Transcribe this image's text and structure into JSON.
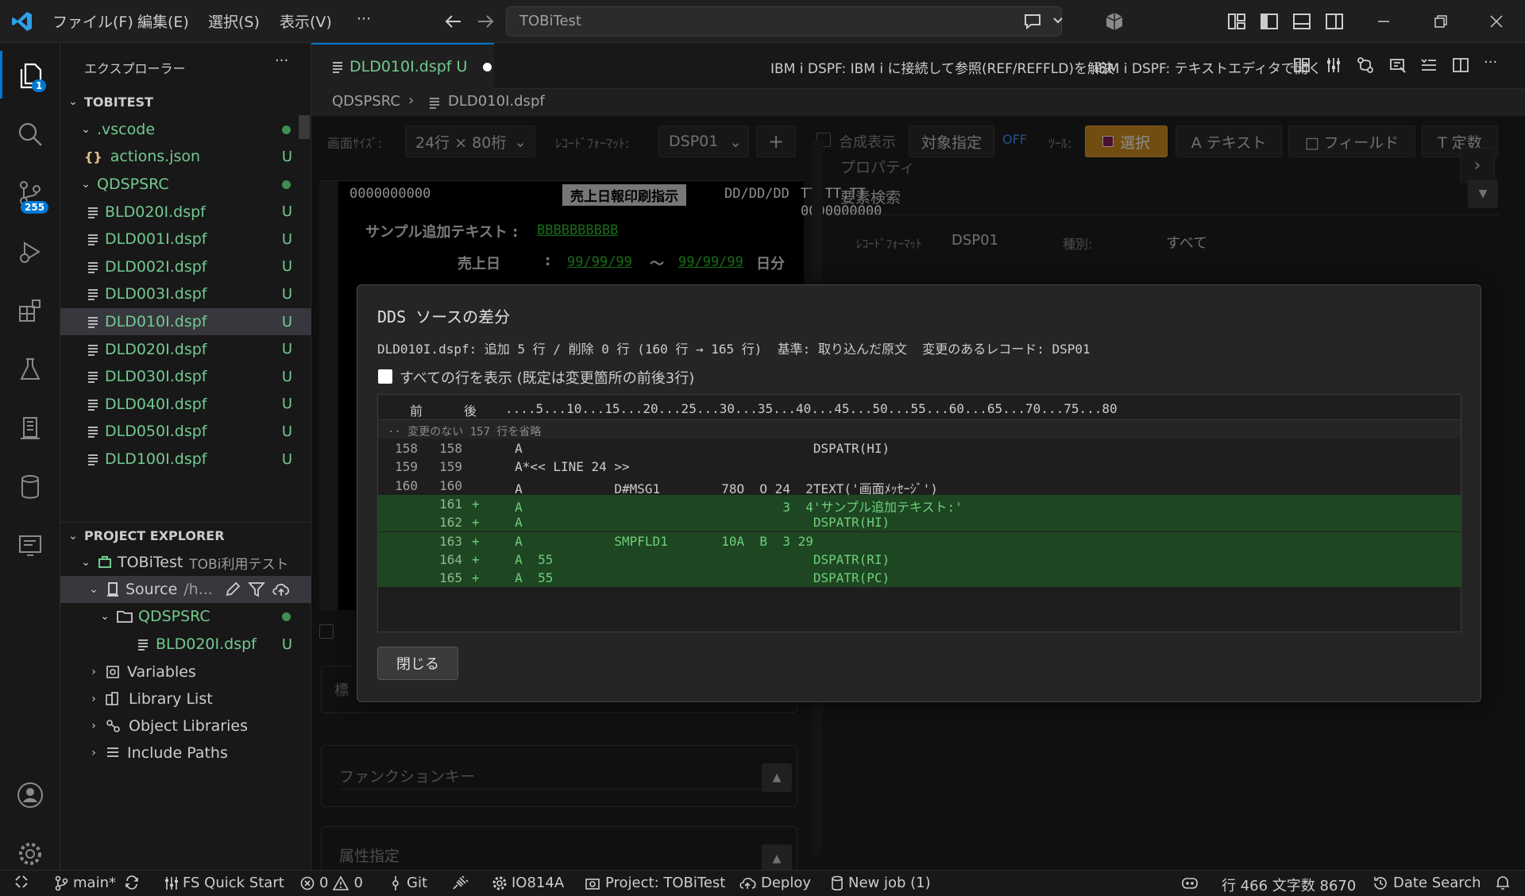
{
  "titlebar": {
    "menus": [
      "ファイル(F)",
      "編集(E)",
      "選択(S)",
      "表示(V)",
      "···"
    ],
    "search_text": "TOBiTest"
  },
  "activity": {
    "scm_badge": "255",
    "explorer_badge": "1",
    "icons": [
      "files-icon",
      "search-icon",
      "source-control-icon",
      "run-debug-icon",
      "extensions-icon",
      "testing-icon",
      "ibmi-icon",
      "database-icon",
      "terminal-panel-icon",
      "account-icon",
      "settings-gear-icon"
    ]
  },
  "sidebar": {
    "title": "エクスプローラー",
    "more": "···",
    "workspace": "TOBITEST",
    "tree": [
      {
        "label": ".vscode",
        "status": "dot"
      },
      {
        "label": "actions.json",
        "status": "U",
        "icon": "{}"
      },
      {
        "label": "QDSPSRC",
        "status": "dot"
      },
      {
        "label": "BLD020I.dspf",
        "status": "U"
      },
      {
        "label": "DLD001I.dspf",
        "status": "U"
      },
      {
        "label": "DLD002I.dspf",
        "status": "U"
      },
      {
        "label": "DLD003I.dspf",
        "status": "U"
      },
      {
        "label": "DLD010I.dspf",
        "status": "U"
      },
      {
        "label": "DLD020I.dspf",
        "status": "U"
      },
      {
        "label": "DLD030I.dspf",
        "status": "U"
      },
      {
        "label": "DLD040I.dspf",
        "status": "U"
      },
      {
        "label": "DLD050I.dspf",
        "status": "U"
      },
      {
        "label": "DLD100I.dspf",
        "status": "U"
      }
    ],
    "project_explorer": {
      "header": "PROJECT EXPLORER",
      "project_name": "TOBiTest",
      "project_desc": "TOBi利用テスト",
      "source_label": "Source",
      "source_path": "/h...",
      "qdspsrc": "QDSPSRC",
      "bld_file": "BLD020I.dspf",
      "bld_status": "U",
      "items": [
        "Variables",
        "Library List",
        "Object Libraries",
        "Include Paths"
      ]
    }
  },
  "editor": {
    "tab_label": "DLD010I.dspf",
    "tab_status": "U",
    "actions": [
      "IBM i DSPF: IBM i に接続して参照(REF/REFFLD)を解決",
      "IBM i DSPF: テキストエディタで開く"
    ],
    "breadcrumb": [
      "QDSPSRC",
      "DLD010I.dspf"
    ],
    "toolbar": {
      "screen_size_label": "画面ｻｲｽﾞ:",
      "screen_size_value": "24行 × 80桁",
      "record_format_label": "ﾚｺｰﾄﾞﾌｫｰﾏｯﾄ:",
      "record_format_value": "DSP01",
      "add": "+",
      "composite": "合成表示",
      "target": "対象指定",
      "off": "OFF",
      "tools_label": "ﾂｰﾙ:",
      "select": "選択",
      "text": "A テキスト",
      "field": "□ フィールド",
      "constant": "T 定数"
    },
    "screen": {
      "line1_left": "0000000000",
      "title": "売上日報印刷指示",
      "date": "DD/DD/DD",
      "time": "TT:TT:TT",
      "line2_right": "0000000000",
      "sample_label": "サンプル追加テキスト :",
      "sample_field": "BBBBBBBBBB",
      "sales_date_label": "売上日",
      "colon": ":",
      "date_from": "99/99/99",
      "tilde": "～",
      "date_to": "99/99/99",
      "day_unit": "日分"
    },
    "props": {
      "title": "プロパティ",
      "search": "要素検索",
      "record_type": "ﾚｺｰﾄﾞﾌｫｰﾏｯﾄ",
      "record_value": "DSP01",
      "kind_label": "種別:",
      "kind_value": "すべて"
    },
    "sections": {
      "std": "標",
      "function_keys": "ファンクションキー",
      "attributes": "属性指定"
    }
  },
  "dialog": {
    "title": "DDS ソースの差分",
    "summary": "DLD010I.dspf: 追加 5 行 / 削除 0 行 (160 行 → 165 行)  基準: 取り込んだ原文  変更のあるレコード: DSP01",
    "show_all": "すべての行を表示 (既定は変更箇所の前後3行)",
    "header_before": "前",
    "header_after": "後",
    "ruler": "....5...10...15...20...25...30...35...40...45...50...55...60...65...70...75...80",
    "omitted": "·· 変更のない 157 行を省略",
    "rows": [
      {
        "before": "158",
        "after": "158",
        "mark": "",
        "src": "     A                                      DSPATR(HI)",
        "added": false
      },
      {
        "before": "159",
        "after": "159",
        "mark": "",
        "src": "     A*<< LINE 24 >>",
        "added": false
      },
      {
        "before": "160",
        "after": "160",
        "mark": "",
        "src": "     A            D#MSG1        78O  O 24  2TEXT('画面ﾒｯｾｰｼﾞ')",
        "added": false
      },
      {
        "before": "",
        "after": "161",
        "mark": "+",
        "src": "     A                                  3  4'サンプル追加テキスト:'",
        "added": true
      },
      {
        "before": "",
        "after": "162",
        "mark": "+",
        "src": "     A                                      DSPATR(HI)",
        "added": true
      },
      {
        "before": "",
        "after": "163",
        "mark": "+",
        "src": "     A            SMPFLD1       10A  B  3 29",
        "added": true
      },
      {
        "before": "",
        "after": "164",
        "mark": "+",
        "src": "     A  55                                  DSPATR(RI)",
        "added": true
      },
      {
        "before": "",
        "after": "165",
        "mark": "+",
        "src": "     A  55                                  DSPATR(PC)",
        "added": true
      }
    ],
    "close": "閉じる"
  },
  "statusbar": {
    "branch": "main*",
    "fs_quick_start": "FS Quick Start",
    "errors": "0",
    "warnings": "0",
    "git": "Git",
    "connection": "IO814A",
    "project": "Project: TOBiTest",
    "deploy": "Deploy",
    "new_job": "New job (1)",
    "position": "行 466 文字数 8670",
    "date_search": "Date Search"
  }
}
